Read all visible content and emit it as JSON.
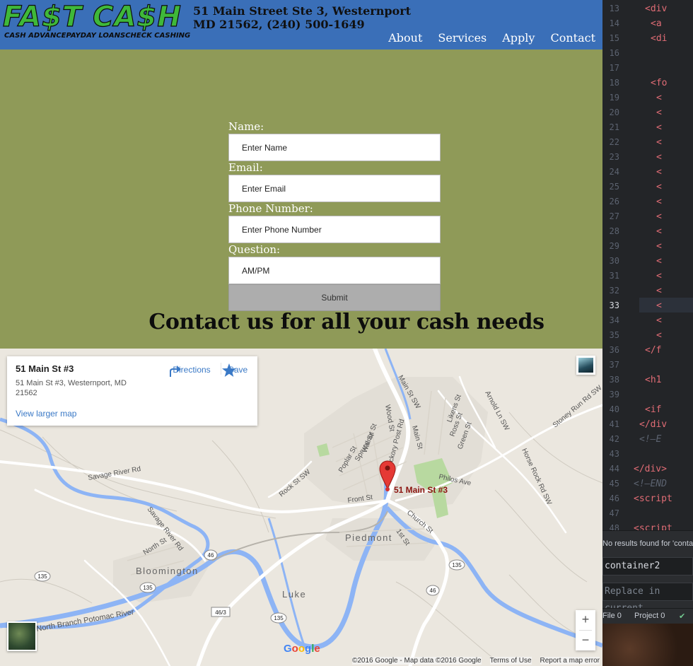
{
  "site": {
    "logo": {
      "title": "FA$T CA$H",
      "tags": [
        "CASH ADVANCE",
        "PAYDAY LOANS",
        "CHECK CASHING"
      ]
    },
    "address_line1": "51 Main Street Ste 3, Westernport",
    "address_line2": "MD 21562, (240) 500-1649",
    "nav": [
      "About",
      "Services",
      "Apply",
      "Contact"
    ],
    "form": {
      "name_label": "Name:",
      "name_placeholder": "Enter Name",
      "email_label": "Email:",
      "email_placeholder": "Enter Email",
      "phone_label": "Phone Number:",
      "phone_placeholder": "Enter Phone Number",
      "question_label": "Question:",
      "question_placeholder": "AM/PM",
      "submit_label": "Submit"
    },
    "headline": "Contact us for all your cash needs"
  },
  "map": {
    "card": {
      "title": "51 Main St #3",
      "address": "51 Main St #3, Westernport, MD 21562",
      "directions_label": "Directions",
      "save_label": "Save",
      "larger_map_link": "View larger map"
    },
    "marker_label": "51 Main St #3",
    "towns": [
      "Bloomington",
      "Piedmont",
      "Luke"
    ],
    "roads": [
      "Savage River Rd",
      "North St",
      "Front St",
      "Church St",
      "1st St",
      "Philos Ave",
      "Rock St SW",
      "Main St SW",
      "Stoney Run Rd SW",
      "Horse Rock Rd SW",
      "Arnold Ln SW",
      "Green St",
      "Ross St",
      "Likens St",
      "Main St",
      "Hickory Post Rd",
      "Wood St",
      "Walnut St",
      "Spruce St",
      "Poplar St",
      "North Branch Potomac River"
    ],
    "route_shields": [
      "135",
      "46",
      "46/3"
    ],
    "zoom_in": "+",
    "zoom_out": "−",
    "google": "Google",
    "attribution": [
      "©2016 Google - Map data ©2016 Google",
      "Terms of Use",
      "Report a map error"
    ],
    "colors": {
      "water": "#8db4f5",
      "park": "#b8d9a0",
      "road": "#ffffff",
      "marker": "#e53935"
    }
  },
  "editor": {
    "lines": [
      {
        "n": "13",
        "text": "<div"
      },
      {
        "n": "14",
        "text": "<a"
      },
      {
        "n": "15",
        "text": "<di"
      },
      {
        "n": "16",
        "text": ""
      },
      {
        "n": "17",
        "text": ""
      },
      {
        "n": "18",
        "text": "<fo"
      },
      {
        "n": "19",
        "text": "<"
      },
      {
        "n": "20",
        "text": "<"
      },
      {
        "n": "21",
        "text": "<"
      },
      {
        "n": "22",
        "text": "<"
      },
      {
        "n": "23",
        "text": "<"
      },
      {
        "n": "24",
        "text": "<"
      },
      {
        "n": "25",
        "text": "<"
      },
      {
        "n": "26",
        "text": "<"
      },
      {
        "n": "27",
        "text": "<"
      },
      {
        "n": "28",
        "text": "<"
      },
      {
        "n": "29",
        "text": "<"
      },
      {
        "n": "30",
        "text": "<"
      },
      {
        "n": "31",
        "text": "<"
      },
      {
        "n": "32",
        "text": "<"
      },
      {
        "n": "33",
        "text": "<"
      },
      {
        "n": "34",
        "text": "<"
      },
      {
        "n": "35",
        "text": "<"
      },
      {
        "n": "36",
        "text": "</f"
      },
      {
        "n": "37",
        "text": ""
      },
      {
        "n": "38",
        "text": "<h1"
      },
      {
        "n": "39",
        "text": ""
      },
      {
        "n": "40",
        "text": "<if"
      },
      {
        "n": "41",
        "text": "</div"
      },
      {
        "n": "42",
        "text": "<!—E"
      },
      {
        "n": "43",
        "text": ""
      },
      {
        "n": "44",
        "text": "</div>"
      },
      {
        "n": "45",
        "text": "<!—END"
      },
      {
        "n": "46",
        "text": "<script"
      },
      {
        "n": "47",
        "text": ""
      },
      {
        "n": "48",
        "text": "<script"
      }
    ],
    "find_message": "No results found for 'conta",
    "find_value": "container2",
    "replace_placeholder": "Replace in current",
    "status": {
      "file": "File 0",
      "project": "Project 0"
    }
  }
}
